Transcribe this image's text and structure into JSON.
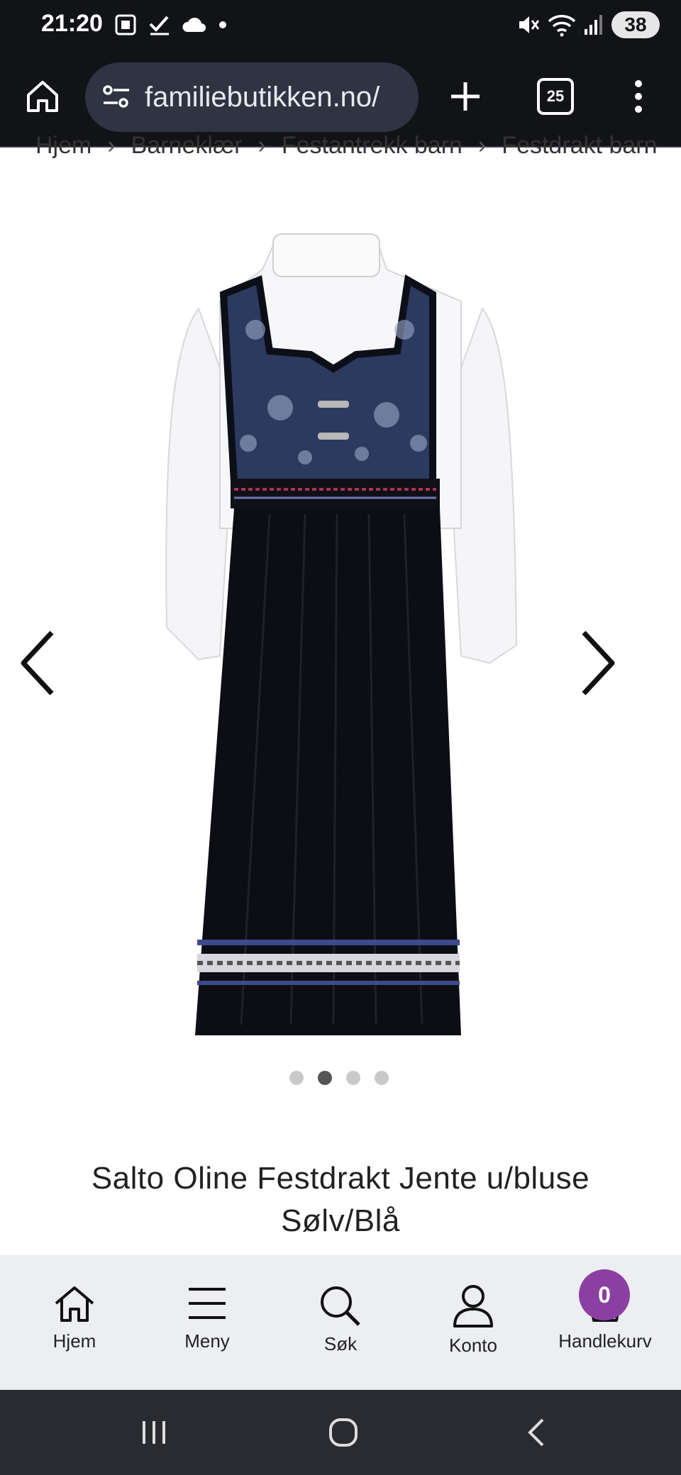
{
  "status_bar": {
    "time": "21:20",
    "battery": "38",
    "left_icons": [
      "screenshot-icon",
      "check-icon",
      "cloud-icon",
      "dot-icon"
    ],
    "right_icons": [
      "mute-icon",
      "wifi-icon",
      "signal-icon",
      "battery-icon"
    ]
  },
  "browser": {
    "url": "familiebutikken.no/",
    "tab_count": "25"
  },
  "breadcrumb": [
    "Hjem",
    "Barneklær",
    "Festantrekk barn",
    "Festdrakt barn"
  ],
  "carousel": {
    "total": 4,
    "active_index": 1
  },
  "product": {
    "title_line1": "Salto Oline Festdrakt Jente u/bluse",
    "title_line2": "Sølv/Blå"
  },
  "site_nav": {
    "home": "Hjem",
    "menu": "Meny",
    "search": "Søk",
    "account": "Konto",
    "cart": "Handlekurv",
    "cart_count": "0"
  },
  "colors": {
    "cart_badge": "#8b3fa3",
    "browser_bg": "#121317",
    "nav_bg": "#eceef1"
  }
}
